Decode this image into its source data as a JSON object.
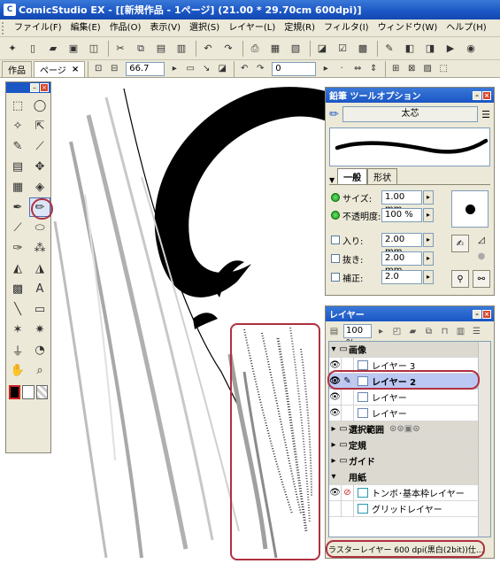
{
  "window": {
    "title": "ComicStudio EX - [[新規作品 - 1ページ] (21.00 * 29.70cm 600dpi)]",
    "icon": "app-icon"
  },
  "menu": [
    "ファイル(F)",
    "編集(E)",
    "作品(O)",
    "表示(V)",
    "選択(S)",
    "レイヤー(L)",
    "定規(R)",
    "フィルタ(I)",
    "ウィンドウ(W)",
    "ヘルプ(H)"
  ],
  "toolbar_icons": [
    "new-icon",
    "new-page-icon",
    "open-icon",
    "save-icon",
    "delete-icon",
    "cut-icon",
    "copy-icon",
    "paste-icon",
    "trash-icon",
    "undo-icon",
    "redo-icon",
    "print-icon",
    "layer-property-icon",
    "book-icon",
    "filter-icon",
    "settings-icon",
    "palette-icon",
    "brush-icon",
    "window-icon",
    "preview-icon",
    "play-icon",
    "app-icon"
  ],
  "tabs": {
    "works": "作品",
    "page": "ページ",
    "close": "×"
  },
  "pagebar": {
    "zoom": "66.7",
    "rotation": "0"
  },
  "tool_options": {
    "title": "鉛筆 ツールオプション",
    "brush_name": "太芯",
    "tab_general": "一般",
    "tab_shape": "形状",
    "size_label": "サイズ:",
    "size_value": "1.00 mm",
    "opacity_label": "不透明度:",
    "opacity_value": "100 %",
    "in_label": "入り:",
    "in_value": "2.00 mm",
    "out_label": "抜き:",
    "out_value": "2.00 mm",
    "correction_label": "補正:",
    "correction_value": "2.0"
  },
  "layers": {
    "title": "レイヤー",
    "zoom": "100 %",
    "groups": {
      "image": "画像",
      "selection": "選択範囲",
      "ruler": "定規",
      "guide": "ガイド",
      "paper": "用紙"
    },
    "items": [
      {
        "name": "レイヤー 3"
      },
      {
        "name": "レイヤー 2"
      },
      {
        "name": "レイヤー"
      },
      {
        "name": "レイヤー"
      }
    ],
    "paper_items": [
      {
        "name": "トンボ･基本枠レイヤー"
      },
      {
        "name": "グリッドレイヤー"
      }
    ],
    "status": "ラスターレイヤー 600 dpi(黒白(2bit))仕..."
  },
  "colors": {
    "title_bar": "#1a56c4",
    "panel_bg": "#ece9d8",
    "selected_layer": "#bcc8f4",
    "highlight_circle": "#b03040"
  }
}
